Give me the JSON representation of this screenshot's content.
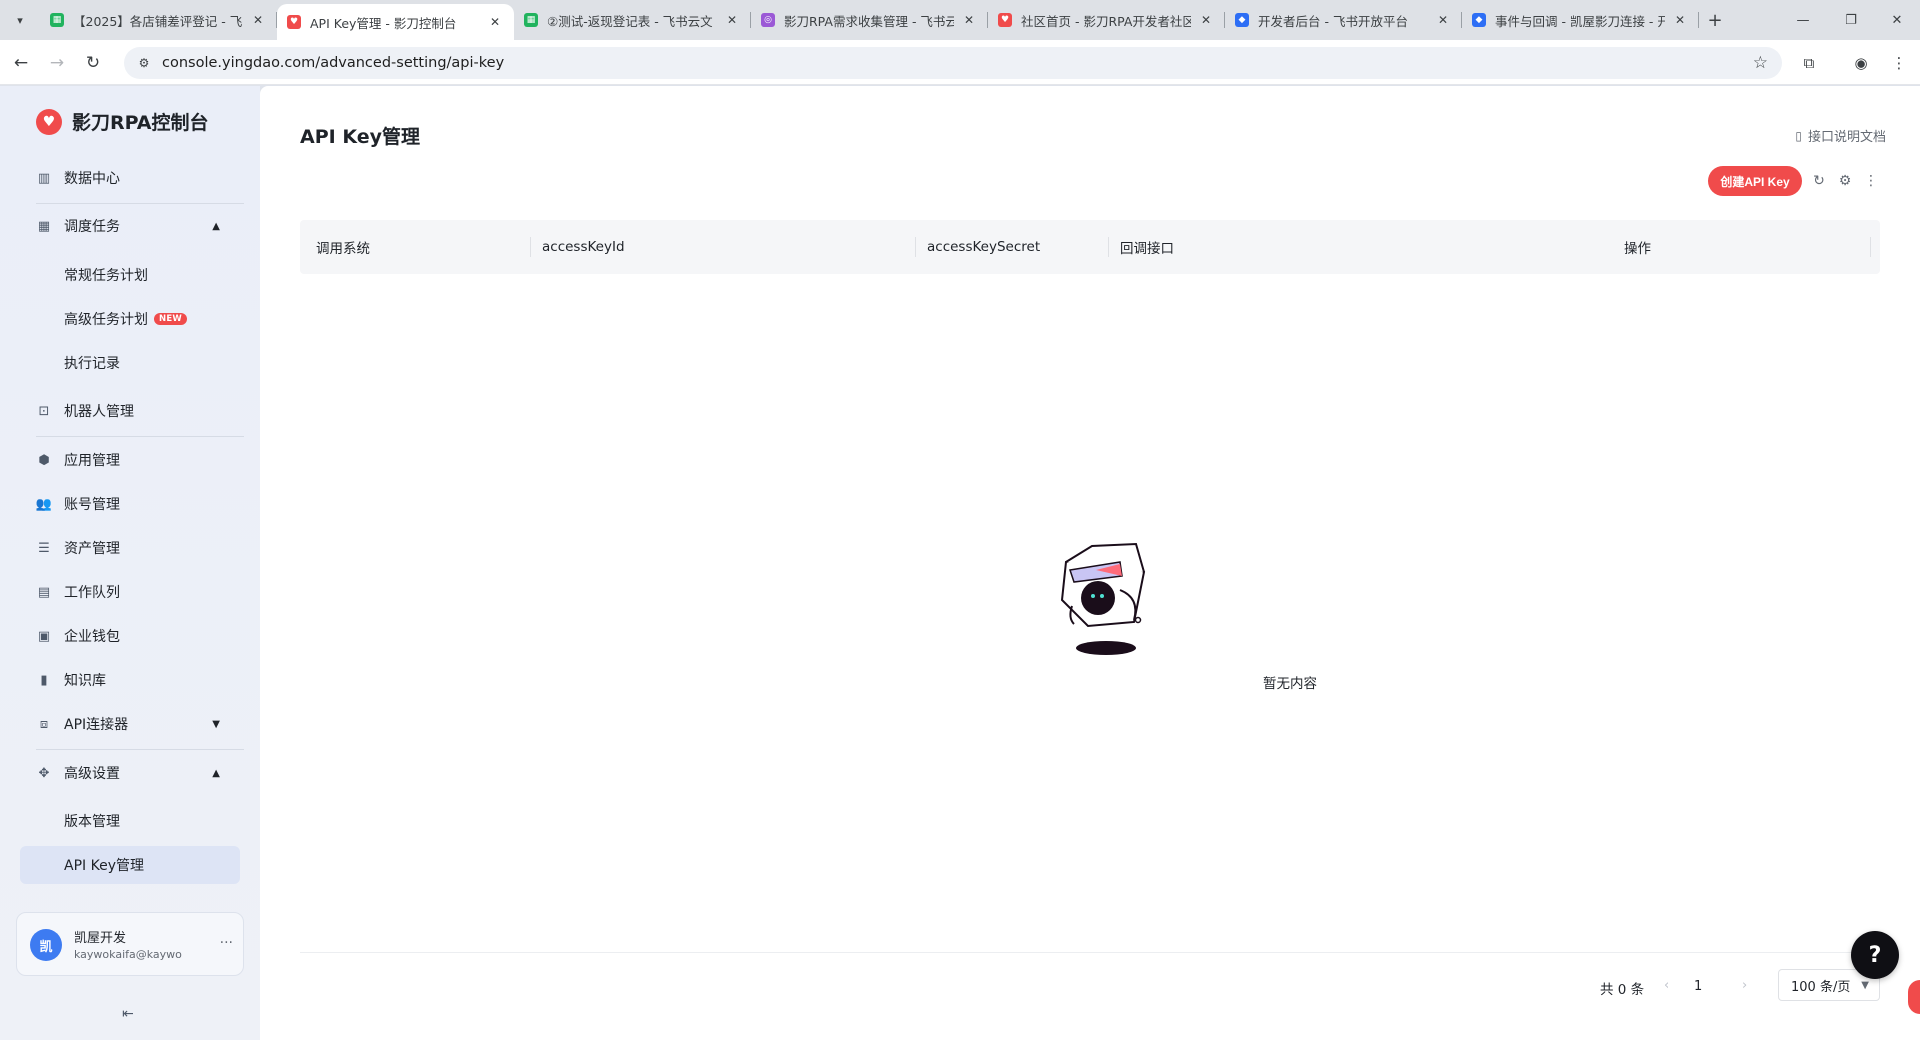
{
  "browser": {
    "tabs": [
      {
        "title": "【2025】各店铺差评登记 - 飞书",
        "favicon_color": "#21b35e",
        "favicon_glyph": "▦"
      },
      {
        "title": "API Key管理 - 影刀控制台",
        "favicon_color": "#f04b4b",
        "favicon_glyph": "♥",
        "active": true
      },
      {
        "title": "②测试-返现登记表 - 飞书云文",
        "favicon_color": "#21b35e",
        "favicon_glyph": "▦"
      },
      {
        "title": "影刀RPA需求收集管理 - 飞书云",
        "favicon_color": "#9b59d6",
        "favicon_glyph": "◎"
      },
      {
        "title": "社区首页 - 影刀RPA开发者社区",
        "favicon_color": "#f04b4b",
        "favicon_glyph": "♥"
      },
      {
        "title": "开发者后台 - 飞书开放平台",
        "favicon_color": "#2d6ef5",
        "favicon_glyph": "◆"
      },
      {
        "title": "事件与回调 - 凯屋影刀连接 - 开",
        "favicon_color": "#2d6ef5",
        "favicon_glyph": "◆"
      }
    ],
    "url": "console.yingdao.com/advanced-setting/api-key"
  },
  "sidebar": {
    "brand": "影刀RPA控制台",
    "items": {
      "data_center": "数据中心",
      "schedule": "调度任务",
      "regular_plan": "常规任务计划",
      "advanced_plan": "高级任务计划",
      "new_badge": "NEW",
      "exec_record": "执行记录",
      "robot": "机器人管理",
      "app": "应用管理",
      "account": "账号管理",
      "asset": "资产管理",
      "queue": "工作队列",
      "wallet": "企业钱包",
      "knowledge": "知识库",
      "api_connector": "API连接器",
      "advanced_setting": "高级设置",
      "version": "版本管理",
      "api_key": "API Key管理"
    },
    "user": {
      "avatar_text": "凯",
      "name": "凯屋开发",
      "email": "kaywokaifa@kaywo"
    }
  },
  "main": {
    "title": "API Key管理",
    "doc_link": "接口说明文档",
    "create_button": "创建API Key",
    "columns": [
      "调用系统",
      "accessKeyId",
      "accessKeySecret",
      "回调接口",
      "操作"
    ],
    "empty_text": "暂无内容",
    "pagination": {
      "total": "共 0 条",
      "page": "1",
      "page_size": "100 条/页"
    }
  },
  "colors": {
    "accent": "#f04b4b",
    "sidebar_active": "#dde4f5",
    "avatar": "#3d7bf1"
  }
}
